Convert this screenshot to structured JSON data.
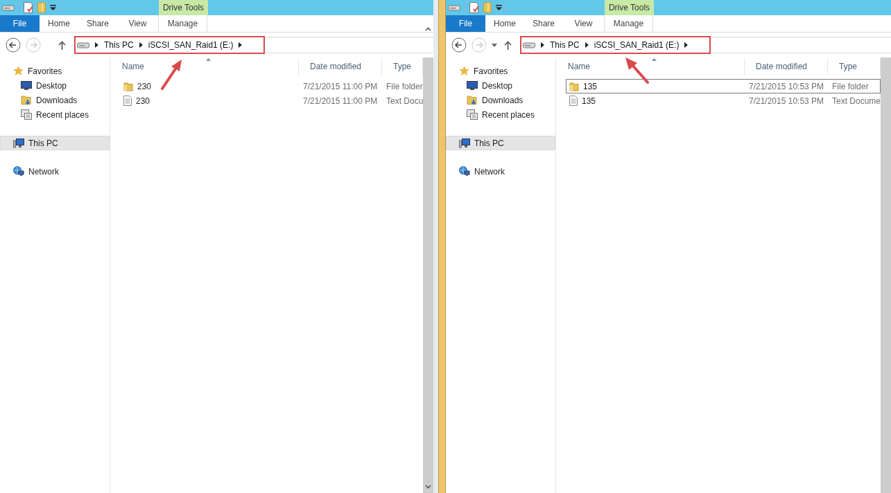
{
  "windows": [
    {
      "contextual_group": "Drive Tools",
      "ribbon_tabs": [
        {
          "label": "File",
          "kind": "file"
        },
        {
          "label": "Home",
          "kind": "tab"
        },
        {
          "label": "Share",
          "kind": "tab"
        },
        {
          "label": "View",
          "kind": "tab"
        },
        {
          "label": "Manage",
          "kind": "contextual"
        }
      ],
      "history_dropdown": false,
      "breadcrumb": [
        "This PC",
        "iSCSI_SAN_Raid1 (E:)"
      ],
      "annotation": {
        "kind": "arrow-up-right"
      },
      "nav": [
        {
          "label": "Favorites",
          "kind": "favorites",
          "selected": false,
          "children": [
            {
              "label": "Desktop",
              "kind": "desktop",
              "selected": false
            },
            {
              "label": "Downloads",
              "kind": "downloads",
              "selected": false
            },
            {
              "label": "Recent places",
              "kind": "recent",
              "selected": false
            }
          ]
        },
        {
          "label": "This PC",
          "kind": "pc",
          "selected": true
        },
        {
          "label": "Network",
          "kind": "network",
          "selected": false
        }
      ],
      "columns": [
        "Name",
        "Date modified",
        "Type"
      ],
      "files": [
        {
          "kind": "folder",
          "name": "230",
          "date": "7/21/2015 11:00 PM",
          "type": "File folder",
          "focused": false
        },
        {
          "kind": "text",
          "name": "230",
          "date": "7/21/2015 11:00 PM",
          "type": "Text Docu",
          "focused": false
        }
      ]
    },
    {
      "contextual_group": "Drive Tools",
      "ribbon_tabs": [
        {
          "label": "File",
          "kind": "file"
        },
        {
          "label": "Home",
          "kind": "tab"
        },
        {
          "label": "Share",
          "kind": "tab"
        },
        {
          "label": "View",
          "kind": "tab"
        },
        {
          "label": "Manage",
          "kind": "contextual"
        }
      ],
      "history_dropdown": true,
      "breadcrumb": [
        "This PC",
        "iSCSI_SAN_Raid1 (E:)"
      ],
      "annotation": {
        "kind": "arrow-up-left"
      },
      "nav": [
        {
          "label": "Favorites",
          "kind": "favorites",
          "selected": false,
          "children": [
            {
              "label": "Desktop",
              "kind": "desktop",
              "selected": false
            },
            {
              "label": "Downloads",
              "kind": "downloads",
              "selected": false
            },
            {
              "label": "Recent places",
              "kind": "recent",
              "selected": false
            }
          ]
        },
        {
          "label": "This PC",
          "kind": "pc",
          "selected": true
        },
        {
          "label": "Network",
          "kind": "network",
          "selected": false
        }
      ],
      "columns": [
        "Name",
        "Date modified",
        "Type"
      ],
      "files": [
        {
          "kind": "folder",
          "name": "135",
          "date": "7/21/2015 10:53 PM",
          "type": "File folder",
          "focused": true
        },
        {
          "kind": "text",
          "name": "135",
          "date": "7/21/2015 10:53 PM",
          "type": "Text Docume",
          "focused": false
        }
      ]
    }
  ]
}
